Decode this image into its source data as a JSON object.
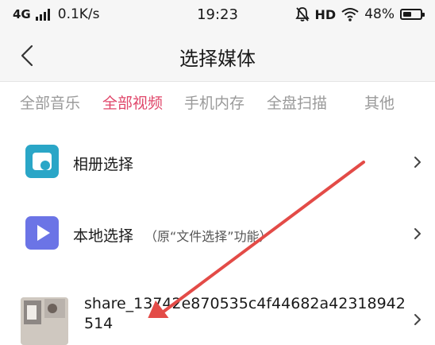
{
  "status_bar": {
    "network": "4G",
    "speed": "0.1K/s",
    "time": "19:23",
    "hd": "HD",
    "battery_percent": "48%",
    "battery_level": 0.48,
    "icons": [
      "signal-bars-icon",
      "mute-icon",
      "wifi-icon",
      "battery-icon"
    ]
  },
  "header": {
    "title": "选择媒体",
    "back_icon": "chevron-left-icon"
  },
  "tabs": [
    {
      "label": "全部音乐",
      "active": false
    },
    {
      "label": "全部视频",
      "active": true
    },
    {
      "label": "手机内存",
      "active": false
    },
    {
      "label": "全盘扫描",
      "active": false
    },
    {
      "label": "其他",
      "active": false
    }
  ],
  "list": {
    "album": {
      "label": "相册选择",
      "icon": "photo-album-icon",
      "icon_color": "#2aa6c7"
    },
    "local": {
      "label": "本地选择",
      "note": "（原“文件选择”功能）",
      "icon": "play-icon",
      "icon_color": "#6b74e6"
    },
    "file": {
      "name": "share_13742e870535c4f44682a42318942514",
      "icon": "video-thumbnail"
    }
  },
  "colors": {
    "accent": "#e0476a",
    "annotation_arrow": "#e34b47"
  }
}
